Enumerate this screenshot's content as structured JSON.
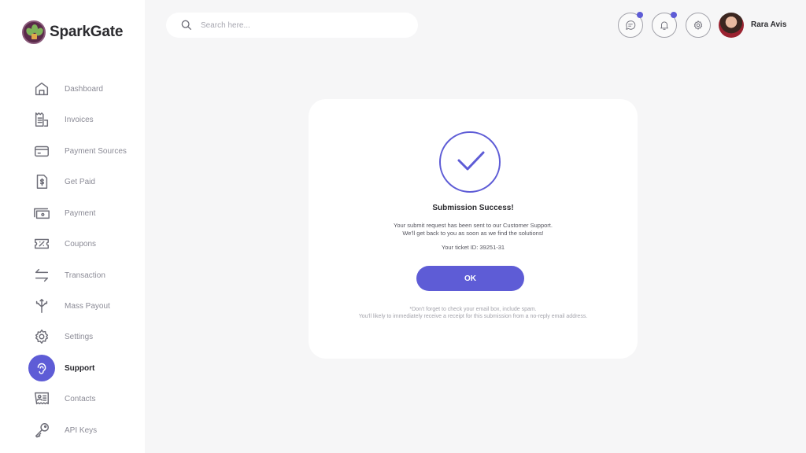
{
  "app": {
    "name": "SparkGate"
  },
  "sidebar": {
    "items": [
      {
        "label": "Dashboard",
        "icon": "home-icon",
        "active": false
      },
      {
        "label": "Invoices",
        "icon": "receipt-icon",
        "active": false
      },
      {
        "label": "Payment Sources",
        "icon": "credit-card-icon",
        "active": false
      },
      {
        "label": "Get Paid",
        "icon": "dollar-document-icon",
        "active": false
      },
      {
        "label": "Payment",
        "icon": "banknote-icon",
        "active": false
      },
      {
        "label": "Coupons",
        "icon": "coupon-icon",
        "active": false
      },
      {
        "label": "Transaction",
        "icon": "arrows-exchange-icon",
        "active": false
      },
      {
        "label": "Mass Payout",
        "icon": "split-arrows-icon",
        "active": false
      },
      {
        "label": "Settings",
        "icon": "gear-icon",
        "active": false
      },
      {
        "label": "Support",
        "icon": "support-icon",
        "active": true
      },
      {
        "label": "Contacts",
        "icon": "contact-card-icon",
        "active": false
      },
      {
        "label": "API  Keys",
        "icon": "key-icon",
        "active": false
      }
    ]
  },
  "header": {
    "search": {
      "placeholder": "Search here...",
      "value": ""
    },
    "messages": {
      "icon": "chat-icon",
      "has_badge": true
    },
    "notifications": {
      "icon": "bell-icon",
      "has_badge": true
    },
    "settings": {
      "icon": "gear-icon"
    },
    "user": {
      "name": "Rara Avis"
    }
  },
  "modal": {
    "icon": "check-circle-icon",
    "title": "Submission Success!",
    "message_line1": "Your submit request has been sent to our Customer Support.",
    "message_line2": "We'll get back to you as soon as we find the solutions!",
    "ticket": "Your ticket ID: 39251-31",
    "ok_label": "OK",
    "note_line1": "*Don't forget to check your email box, include spam.",
    "note_line2": "You'll likely to immediately receive a receipt for this submission from a no-reply email address."
  },
  "colors": {
    "accent": "#5e5cd6",
    "background": "#f6f6f7",
    "card": "#ffffff"
  }
}
